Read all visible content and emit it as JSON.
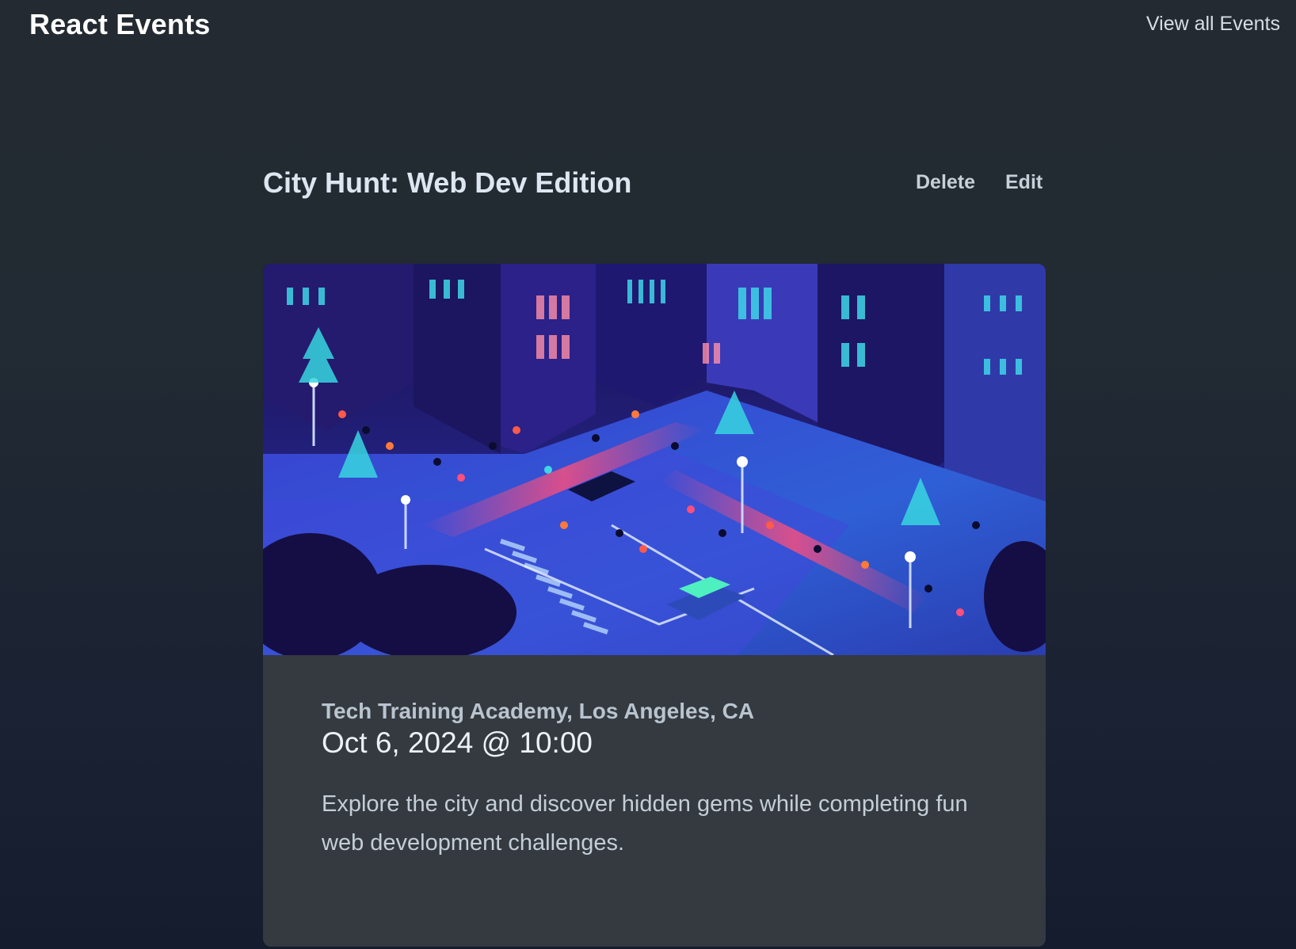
{
  "header": {
    "brand": "React Events",
    "nav_link": "View all Events"
  },
  "event": {
    "title": "City Hunt: Web Dev Edition",
    "actions": {
      "delete_label": "Delete",
      "edit_label": "Edit"
    },
    "image_alt": "Isometric illustration of a busy neon-lit city street at night",
    "location": "Tech Training Academy, Los Angeles, CA",
    "datetime": "Oct 6, 2024 @ 10:00",
    "description": "Explore the city and discover hidden gems while completing fun web development challenges."
  },
  "colors": {
    "background": "#222a33",
    "card": "#343a40",
    "text": "#e6edf3",
    "image_base": "#1b1561",
    "image_accent": "#ff4f7a"
  }
}
